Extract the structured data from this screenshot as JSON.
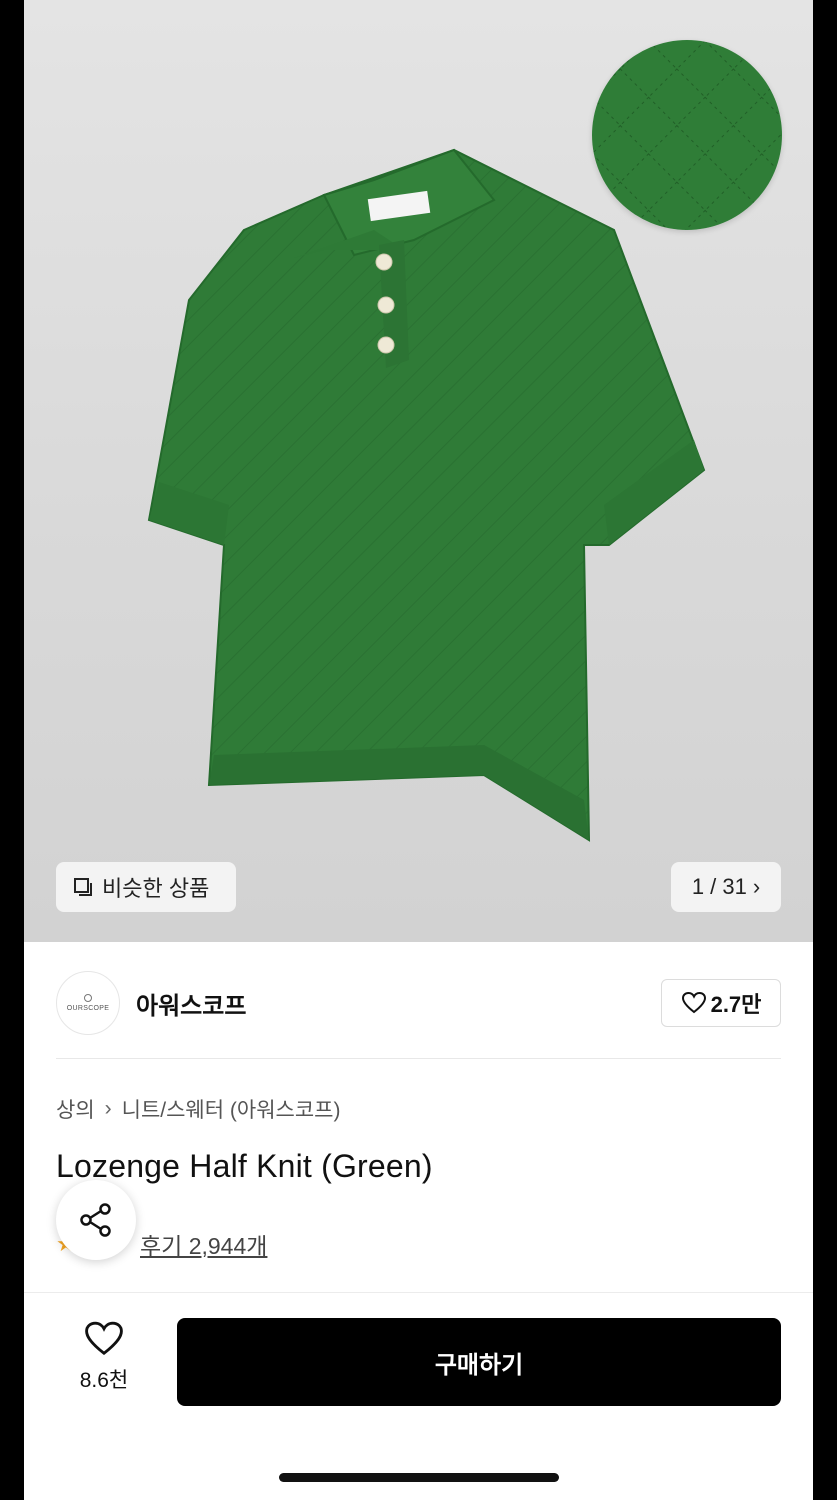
{
  "hero": {
    "similar_label": "비슷한 상품",
    "counter": "1 / 31",
    "product_color": "#2e7a36"
  },
  "brand": {
    "logo_text": "OURSCOPE",
    "name": "아워스코프",
    "likes": "2.7만"
  },
  "breadcrumb": {
    "category": "상의",
    "subcategory": "니트/스웨터 (아워스코프)"
  },
  "product": {
    "title": "Lozenge Half Knit (Green)",
    "review_link": "후기 2,944개"
  },
  "bottom_bar": {
    "favorite_count": "8.6천",
    "buy_label": "구매하기"
  },
  "icons": {
    "similar": "similar-products-icon",
    "heart": "heart-icon",
    "share": "share-icon",
    "star": "star-icon"
  }
}
